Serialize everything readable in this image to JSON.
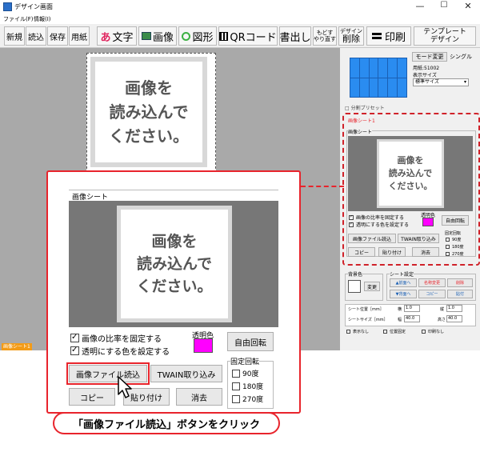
{
  "window": {
    "title": "デザイン画面",
    "minimize": "—",
    "maximize": "☐",
    "close": "✕"
  },
  "menu": {
    "file": "ファイル(F)",
    "edit": "情報(I)"
  },
  "toolbar": {
    "new": "新規",
    "load": "読込",
    "save": "保存",
    "paper": "用紙",
    "text": "文字",
    "text_glyph": "あ",
    "image": "画像",
    "shape": "図形",
    "qrcode": "QRコード",
    "export": "書出し",
    "undo_top": "もどす",
    "undo_bottom": "やり直す",
    "delete_top": "デザイン",
    "delete_bottom": "削除",
    "print": "印刷",
    "template_top": "テンプレート",
    "template_bottom": "デザイン"
  },
  "canvas": {
    "placeholder": "画像を\n読み込んで\nください。"
  },
  "status": {
    "label": "画像シート1"
  },
  "right": {
    "mode_btn": "モード変更",
    "mode_value": "シングル",
    "paper_info": "用紙:51002",
    "display_size_label": "表示サイズ",
    "display_size_value": "標準サイズ",
    "sheet_title": "画像シート1",
    "sheet_group": "画像シート",
    "sheet_placeholder": "画像を\n読み込んで\nください。",
    "transparent_label": "透明色",
    "keep_ratio": "画像の比率を固定する",
    "transparent_set": "透明にする色を設定する",
    "free_rotate": "自由回転",
    "fixed_rotate": "固定回転",
    "rot90": "90度",
    "rot180": "180度",
    "rot270": "270度",
    "load_file": "画像ファイル読込",
    "twain": "TWAIN取り込み",
    "copy": "コピー",
    "paste": "貼り付け",
    "clear": "消去",
    "bg_label": "背景色",
    "change": "変更",
    "sheet_settings": "シート設定",
    "front": "▲前面へ",
    "rename": "名称変更",
    "delete": "削除",
    "back": "▼背面へ",
    "copy2": "コピー",
    "paste2": "貼付",
    "pos_label": "シート位置［mm］",
    "horiz": "横",
    "vert": "縦",
    "pos_x": "1.0",
    "pos_y": "1.0",
    "size_label": "シートサイズ［mm］",
    "width": "幅",
    "height": "高さ",
    "size_w": "40.0",
    "size_h": "40.0",
    "hide": "表示なし",
    "lock": "位置固定",
    "noprint": "印刷なし",
    "cut_label": "□ 分割プリセット"
  },
  "zoom": {
    "group_label": "画像シート",
    "placeholder": "画像を\n読み込んで\nください。",
    "keep_ratio": "画像の比率を固定する",
    "transparent_set": "透明にする色を設定する",
    "transparent_label": "透明色",
    "free_rotate": "自由回転",
    "fixed_rotate": "固定回転",
    "rot90": "90度",
    "rot180": "180度",
    "rot270": "270度",
    "load_file": "画像ファイル読込",
    "twain": "TWAIN取り込み",
    "copy": "コピー",
    "paste": "貼り付け",
    "clear": "消去"
  },
  "callout": {
    "text": "「画像ファイル読込」ボタンをクリック"
  },
  "colors": {
    "accent_red": "#e8242c",
    "transparent_swatch": "#ff00ff",
    "sheet_orange": "#f39b16",
    "grid_blue": "#2a8cf0"
  }
}
